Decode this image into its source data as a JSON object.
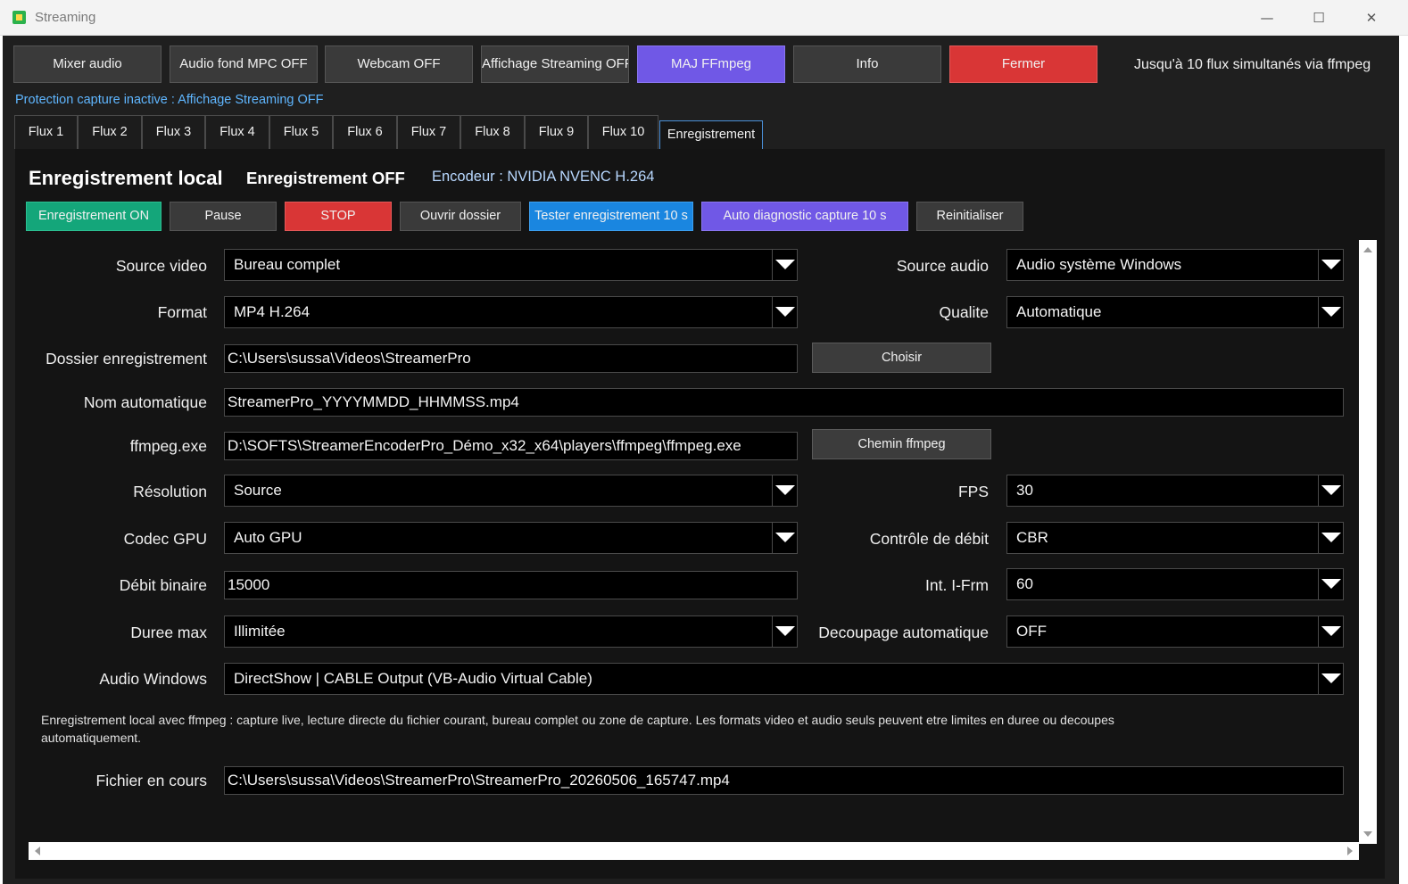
{
  "window": {
    "title": "Streaming",
    "controls": {
      "minimize": "—",
      "maximize": "☐",
      "close": "✕"
    }
  },
  "toolbar": {
    "buttons": [
      {
        "label": "Mixer audio"
      },
      {
        "label": "Audio fond MPC OFF"
      },
      {
        "label": "Webcam OFF"
      },
      {
        "label": "Affichage Streaming OFF"
      },
      {
        "label": "MAJ FFmpeg",
        "color": "#7058e6"
      },
      {
        "label": "Info"
      },
      {
        "label": "Fermer",
        "color": "#d93636"
      }
    ],
    "note": "Jusqu'à 10 flux simultanés via ffmpeg"
  },
  "protection_status": "Protection capture inactive : Affichage Streaming OFF",
  "tabs": [
    "Flux 1",
    "Flux 2",
    "Flux 3",
    "Flux 4",
    "Flux 5",
    "Flux 6",
    "Flux 7",
    "Flux 8",
    "Flux 9",
    "Flux 10",
    "Enregistrement"
  ],
  "active_tab": "Enregistrement",
  "header": {
    "title": "Enregistrement local",
    "status": "Enregistrement OFF",
    "encoder": "Encodeur : NVIDIA NVENC H.264"
  },
  "actions": [
    {
      "label": "Enregistrement ON",
      "color": "#14a67a"
    },
    {
      "label": "Pause"
    },
    {
      "label": "STOP",
      "color": "#d93636"
    },
    {
      "label": "Ouvrir dossier"
    },
    {
      "label": "Tester enregistrement 10 s",
      "color": "#1a86e0"
    },
    {
      "label": "Auto diagnostic capture 10 s",
      "color": "#7058e6"
    },
    {
      "label": "Reinitialiser"
    }
  ],
  "form": {
    "source_video": {
      "label": "Source video",
      "value": "Bureau complet"
    },
    "source_audio": {
      "label": "Source audio",
      "value": "Audio système Windows"
    },
    "format": {
      "label": "Format",
      "value": "MP4 H.264"
    },
    "qualite": {
      "label": "Qualite",
      "value": "Automatique"
    },
    "dossier": {
      "label": "Dossier enregistrement",
      "value": "C:\\Users\\sussa\\Videos\\StreamerPro",
      "button": "Choisir"
    },
    "nom_auto": {
      "label": "Nom automatique",
      "value": "StreamerPro_YYYYMMDD_HHMMSS.mp4"
    },
    "ffmpeg": {
      "label": "ffmpeg.exe",
      "value": "D:\\SOFTS\\StreamerEncoderPro_Démo_x32_x64\\players\\ffmpeg\\ffmpeg.exe",
      "button": "Chemin ffmpeg"
    },
    "resolution": {
      "label": "Résolution",
      "value": "Source"
    },
    "fps": {
      "label": "FPS",
      "value": "30"
    },
    "codec_gpu": {
      "label": "Codec GPU",
      "value": "Auto GPU"
    },
    "controle_debit": {
      "label": "Contrôle de débit",
      "value": "CBR"
    },
    "debit_binaire": {
      "label": "Débit binaire",
      "value": "15000"
    },
    "int_ifrm": {
      "label": "Int. I-Frm",
      "value": "60"
    },
    "duree_max": {
      "label": "Duree max",
      "value": "Illimitée"
    },
    "decoupage": {
      "label": "Decoupage automatique",
      "value": "OFF"
    },
    "audio_windows": {
      "label": "Audio Windows",
      "value": "DirectShow | CABLE Output (VB-Audio Virtual Cable)"
    },
    "description": "Enregistrement local avec ffmpeg : capture live, lecture directe du fichier courant, bureau complet ou zone de capture. Les formats video et audio seuls peuvent etre limites en duree ou decoupes automatiquement.",
    "fichier_en_cours": {
      "label": "Fichier en cours",
      "value": "C:\\Users\\sussa\\Videos\\StreamerPro\\StreamerPro_20260506_165747.mp4"
    }
  }
}
